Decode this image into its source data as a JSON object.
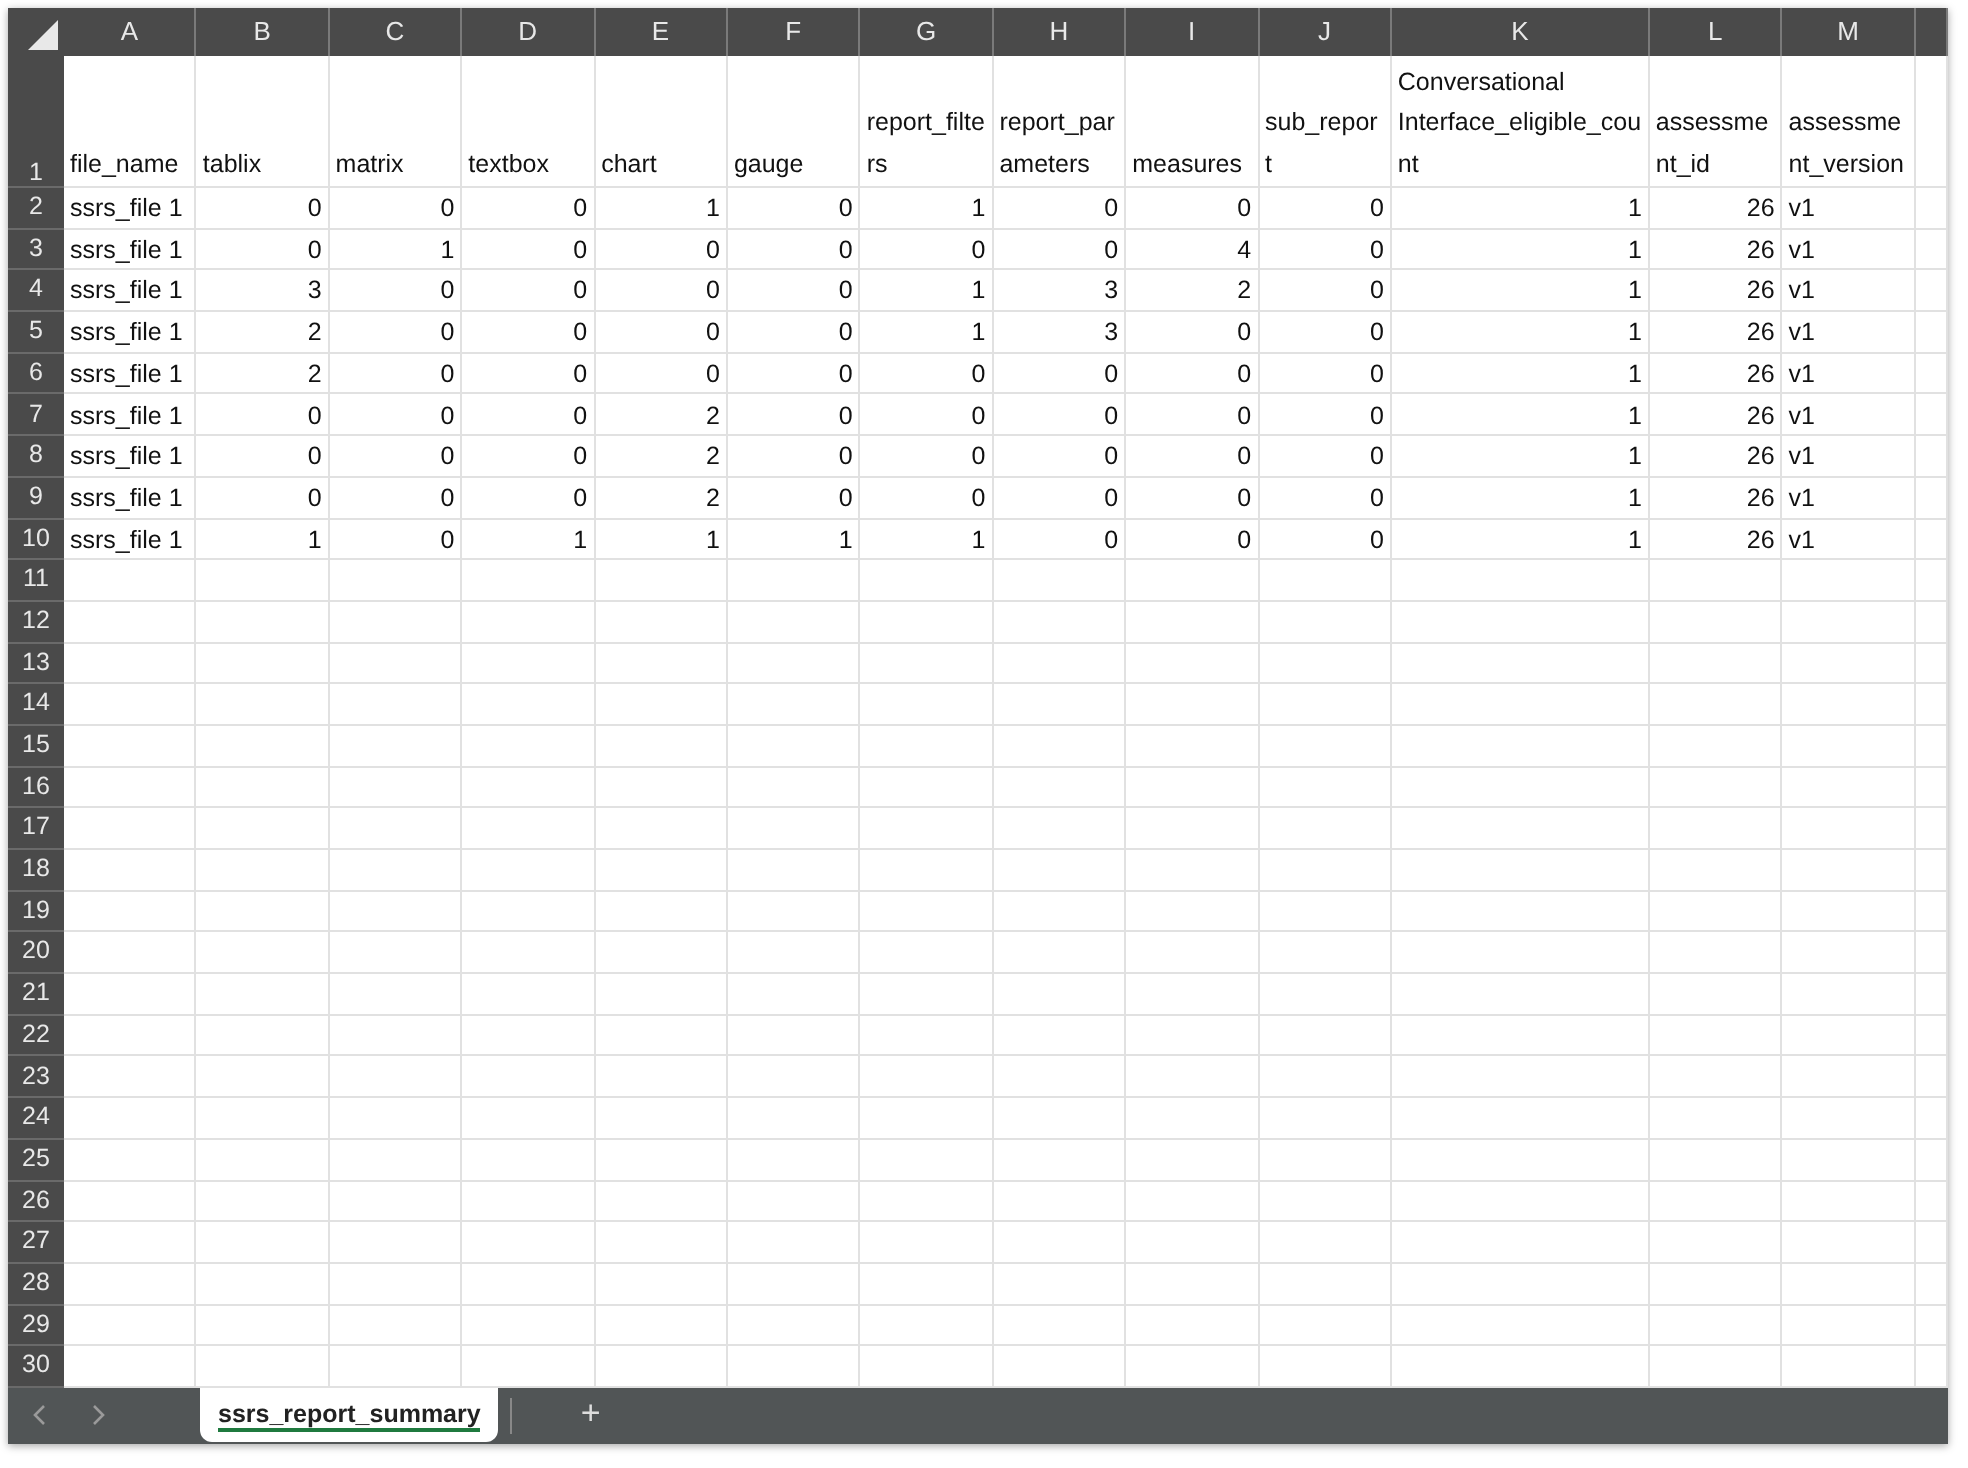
{
  "columns": [
    {
      "letter": "A",
      "header": "file_name",
      "kind": "text"
    },
    {
      "letter": "B",
      "header": "tablix",
      "kind": "number"
    },
    {
      "letter": "C",
      "header": "matrix",
      "kind": "number"
    },
    {
      "letter": "D",
      "header": "textbox",
      "kind": "number"
    },
    {
      "letter": "E",
      "header": "chart",
      "kind": "number"
    },
    {
      "letter": "F",
      "header": "gauge",
      "kind": "number"
    },
    {
      "letter": "G",
      "header": "report_filters",
      "kind": "number"
    },
    {
      "letter": "H",
      "header": "report_parameters",
      "kind": "number"
    },
    {
      "letter": "I",
      "header": "measures",
      "kind": "number"
    },
    {
      "letter": "J",
      "header": "sub_report",
      "kind": "number"
    },
    {
      "letter": "K",
      "header": "Conversational Interface_eligible_count",
      "kind": "number"
    },
    {
      "letter": "L",
      "header": "assessment_id",
      "kind": "number"
    },
    {
      "letter": "M",
      "header": "assessment_version",
      "kind": "text"
    }
  ],
  "header_row_number": "1",
  "rows": [
    {
      "number": "2",
      "cells": [
        "ssrs_file 1",
        "0",
        "0",
        "0",
        "1",
        "0",
        "1",
        "0",
        "0",
        "0",
        "1",
        "26",
        "v1"
      ]
    },
    {
      "number": "3",
      "cells": [
        "ssrs_file 1",
        "0",
        "1",
        "0",
        "0",
        "0",
        "0",
        "0",
        "4",
        "0",
        "1",
        "26",
        "v1"
      ]
    },
    {
      "number": "4",
      "cells": [
        "ssrs_file 1",
        "3",
        "0",
        "0",
        "0",
        "0",
        "1",
        "3",
        "2",
        "0",
        "1",
        "26",
        "v1"
      ]
    },
    {
      "number": "5",
      "cells": [
        "ssrs_file 1",
        "2",
        "0",
        "0",
        "0",
        "0",
        "1",
        "3",
        "0",
        "0",
        "1",
        "26",
        "v1"
      ]
    },
    {
      "number": "6",
      "cells": [
        "ssrs_file 1",
        "2",
        "0",
        "0",
        "0",
        "0",
        "0",
        "0",
        "0",
        "0",
        "1",
        "26",
        "v1"
      ]
    },
    {
      "number": "7",
      "cells": [
        "ssrs_file 1",
        "0",
        "0",
        "0",
        "2",
        "0",
        "0",
        "0",
        "0",
        "0",
        "1",
        "26",
        "v1"
      ]
    },
    {
      "number": "8",
      "cells": [
        "ssrs_file 1",
        "0",
        "0",
        "0",
        "2",
        "0",
        "0",
        "0",
        "0",
        "0",
        "1",
        "26",
        "v1"
      ]
    },
    {
      "number": "9",
      "cells": [
        "ssrs_file 1",
        "0",
        "0",
        "0",
        "2",
        "0",
        "0",
        "0",
        "0",
        "0",
        "1",
        "26",
        "v1"
      ]
    },
    {
      "number": "10",
      "cells": [
        "ssrs_file 1",
        "1",
        "0",
        "1",
        "1",
        "1",
        "1",
        "0",
        "0",
        "0",
        "1",
        "26",
        "v1"
      ]
    },
    {
      "number": "11"
    },
    {
      "number": "12"
    },
    {
      "number": "13"
    },
    {
      "number": "14"
    },
    {
      "number": "15"
    },
    {
      "number": "16"
    },
    {
      "number": "17"
    },
    {
      "number": "18"
    },
    {
      "number": "19"
    },
    {
      "number": "20"
    },
    {
      "number": "21"
    },
    {
      "number": "22"
    },
    {
      "number": "23"
    },
    {
      "number": "24"
    },
    {
      "number": "25"
    },
    {
      "number": "26"
    },
    {
      "number": "27"
    },
    {
      "number": "28"
    },
    {
      "number": "29"
    },
    {
      "number": "30"
    }
  ],
  "sheet_tabs": [
    {
      "label": "ssrs_report_summary",
      "selected": true
    }
  ],
  "add_sheet": "+"
}
